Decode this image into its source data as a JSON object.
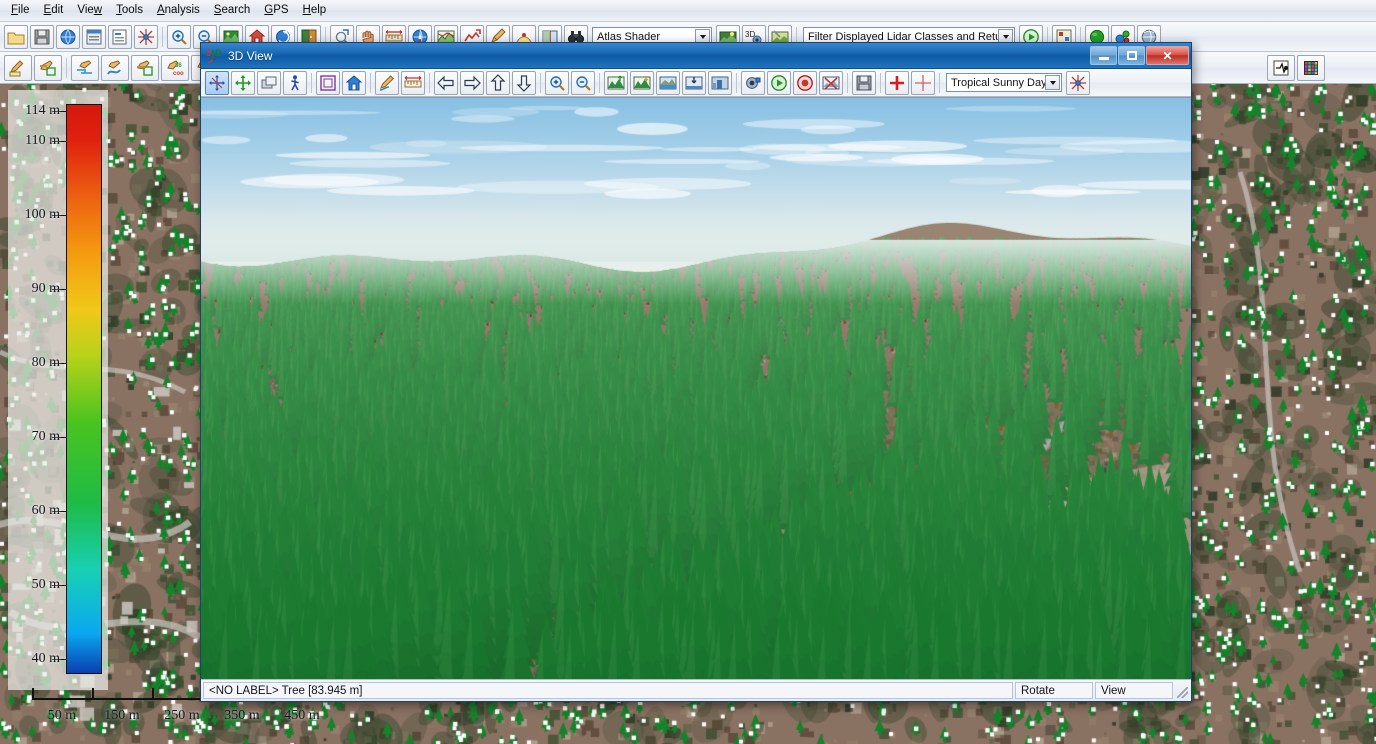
{
  "app": {
    "menu": [
      {
        "label": "File",
        "accel": "F"
      },
      {
        "label": "Edit",
        "accel": "E"
      },
      {
        "label": "View",
        "accel": "w"
      },
      {
        "label": "Tools",
        "accel": "T"
      },
      {
        "label": "Analysis",
        "accel": "A"
      },
      {
        "label": "Search",
        "accel": "S"
      },
      {
        "label": "GPS",
        "accel": "G"
      },
      {
        "label": "Help",
        "accel": "H"
      }
    ],
    "toolbar_row1": {
      "groups": [
        {
          "items": [
            {
              "name": "open-file-icon",
              "glyph": "folder"
            },
            {
              "name": "save-file-icon",
              "glyph": "floppy"
            },
            {
              "name": "globe-icon",
              "glyph": "globe"
            },
            {
              "name": "control-center-icon",
              "glyph": "window-list"
            },
            {
              "name": "layer-properties-icon",
              "glyph": "layers-doc"
            },
            {
              "name": "config-icon",
              "glyph": "config-star"
            }
          ]
        },
        {
          "items": [
            {
              "name": "zoom-in-icon",
              "glyph": "zoom-in"
            },
            {
              "name": "zoom-out-icon",
              "glyph": "zoom-out"
            },
            {
              "name": "full-view-icon",
              "glyph": "full-view"
            },
            {
              "name": "home-view-icon",
              "glyph": "home"
            },
            {
              "name": "previous-view-icon",
              "glyph": "reload-arrow"
            },
            {
              "name": "next-view-icon",
              "glyph": "door"
            }
          ]
        },
        {
          "items": [
            {
              "name": "zoom-tool-icon",
              "glyph": "magnify-rect"
            },
            {
              "name": "pan-tool-icon",
              "glyph": "hand"
            },
            {
              "name": "measure-tool-icon",
              "glyph": "ruler"
            },
            {
              "name": "feature-info-tool-icon",
              "glyph": "info-globe"
            },
            {
              "name": "path-profile-icon",
              "glyph": "profile"
            },
            {
              "name": "coverage-icon",
              "glyph": "coverage-red"
            },
            {
              "name": "digitizer-icon",
              "glyph": "digitizer"
            },
            {
              "name": "viewshed-icon",
              "glyph": "viewshed"
            },
            {
              "name": "image-swipe-icon",
              "glyph": "swipe"
            },
            {
              "name": "search-binoculars-icon",
              "glyph": "binoculars"
            }
          ]
        },
        {
          "items": []
        }
      ],
      "shader_combo": {
        "name": "shader-select",
        "value": "Atlas Shader"
      },
      "after_shader": [
        {
          "name": "shader-options-icon",
          "glyph": "shader-opt"
        },
        {
          "name": "enable-3d-icon",
          "glyph": "three-d"
        },
        {
          "name": "terrain-paint-icon",
          "glyph": "terrain-paint"
        }
      ],
      "filter_combo": {
        "name": "lidar-filter-select",
        "value": "Filter Displayed Lidar Classes and Return Types"
      },
      "after_filter": [
        {
          "name": "play-lidar-icon",
          "glyph": "play-green"
        },
        {
          "name": "lidar-draw-mode-icon",
          "glyph": "lidar-mode"
        },
        {
          "name": "green-sphere-icon",
          "glyph": "green-sphere"
        },
        {
          "name": "point-cloud-icon",
          "glyph": "point-cloud"
        },
        {
          "name": "globe-shade-icon",
          "glyph": "globe-shade"
        }
      ]
    },
    "toolbar_row2": {
      "items": [
        {
          "name": "digitize-area-icon",
          "glyph": "pen-area"
        },
        {
          "name": "digitize-rect-icon",
          "glyph": "pen-rect"
        },
        {
          "name": "digitize-line-icon",
          "glyph": "pen-line"
        },
        {
          "name": "digitize-curve-icon",
          "glyph": "pen-curve"
        },
        {
          "name": "digitize-square-icon",
          "glyph": "pen-square"
        },
        {
          "name": "digitize-coord-icon",
          "glyph": "pen-coord"
        },
        {
          "name": "digitize-range-rings-icon",
          "glyph": "pen-rings"
        },
        {
          "name": "edit-vertex-icon",
          "glyph": "pen-vertex"
        },
        {
          "name": "crop-combine-icon",
          "glyph": "crop"
        },
        {
          "name": "lidar-classify-icon",
          "glyph": "lidar-class"
        },
        {
          "name": "lidar-grid-icon",
          "glyph": "lidar-grid"
        }
      ]
    }
  },
  "legend": {
    "name": "elevation-color-legend",
    "unit": "m",
    "ticks": [
      {
        "label": "114 m",
        "value": 114
      },
      {
        "label": "110 m",
        "value": 110
      },
      {
        "label": "100 m",
        "value": 100
      },
      {
        "label": "90 m",
        "value": 90
      },
      {
        "label": "80 m",
        "value": 80
      },
      {
        "label": "70 m",
        "value": 70
      },
      {
        "label": "60 m",
        "value": 60
      },
      {
        "label": "50 m",
        "value": 50
      },
      {
        "label": "40 m",
        "value": 40
      }
    ],
    "min": 38,
    "max": 115,
    "gradient_stops": [
      {
        "pos": 0,
        "color": "#0a3fb0"
      },
      {
        "pos": 7,
        "color": "#0aa8f0"
      },
      {
        "pos": 18,
        "color": "#18d0b4"
      },
      {
        "pos": 30,
        "color": "#1fbb45"
      },
      {
        "pos": 44,
        "color": "#49c41f"
      },
      {
        "pos": 56,
        "color": "#b9d21a"
      },
      {
        "pos": 64,
        "color": "#f0c81a"
      },
      {
        "pos": 74,
        "color": "#f59a10"
      },
      {
        "pos": 84,
        "color": "#ec5f11"
      },
      {
        "pos": 94,
        "color": "#e02010"
      },
      {
        "pos": 100,
        "color": "#d5190c"
      }
    ]
  },
  "scalebar": {
    "name": "map-scale-bar",
    "labels": [
      "50 m",
      "150 m",
      "250 m",
      "350 m",
      "450 m"
    ],
    "tick_count": 6
  },
  "window3d": {
    "title": "3D View",
    "title_icon": "3d-axes-icon",
    "buttons": {
      "minimize": "minimize-button",
      "maximize": "maximize-button",
      "close": "close-button"
    },
    "toolbar": {
      "items": [
        {
          "name": "rotate-mode-icon",
          "glyph": "rotate-mode",
          "active": true
        },
        {
          "name": "pan-mode-icon",
          "glyph": "move-arrows"
        },
        {
          "name": "layers-icon",
          "glyph": "stack"
        },
        {
          "name": "walk-mode-icon",
          "glyph": "walker"
        },
        {
          "sep": true
        },
        {
          "name": "bounding-box-icon",
          "glyph": "bbox"
        },
        {
          "name": "home-view-icon",
          "glyph": "home-blue"
        },
        {
          "sep": true
        },
        {
          "name": "draw-path-icon",
          "glyph": "pencil-path"
        },
        {
          "name": "measure-icon",
          "glyph": "ruler-red"
        },
        {
          "sep": true
        },
        {
          "name": "rotate-left-icon",
          "glyph": "arrow-left"
        },
        {
          "name": "rotate-right-icon",
          "glyph": "arrow-right"
        },
        {
          "name": "tilt-up-icon",
          "glyph": "arrow-up"
        },
        {
          "name": "tilt-down-icon",
          "glyph": "arrow-down"
        },
        {
          "sep": true
        },
        {
          "name": "zoom-in-icon",
          "glyph": "zoom-in"
        },
        {
          "name": "zoom-out-icon",
          "glyph": "zoom-out"
        },
        {
          "sep": true
        },
        {
          "name": "vertical-exaggeration-up-icon",
          "glyph": "vexag-up"
        },
        {
          "name": "vertical-exaggeration-down-icon",
          "glyph": "vexag-down"
        },
        {
          "name": "water-level-icon",
          "glyph": "water"
        },
        {
          "name": "water-down-icon",
          "glyph": "water-down"
        },
        {
          "name": "texture-icon",
          "glyph": "texture"
        },
        {
          "sep": true
        },
        {
          "name": "record-settings-icon",
          "glyph": "camera-rec"
        },
        {
          "name": "play-flythrough-icon",
          "glyph": "play-green"
        },
        {
          "name": "stop-flythrough-icon",
          "glyph": "stop-red"
        },
        {
          "name": "export-image-icon",
          "glyph": "export-img"
        },
        {
          "sep": true
        },
        {
          "name": "save-view-icon",
          "glyph": "floppy-gray"
        },
        {
          "sep": true
        },
        {
          "name": "add-point-icon",
          "glyph": "plus-red"
        },
        {
          "name": "crosshair-icon",
          "glyph": "crosshair"
        },
        {
          "sep": true
        }
      ],
      "sky_combo": {
        "name": "sky-background-select",
        "value": "Tropical Sunny Day"
      },
      "after_combo": [
        {
          "name": "sky-settings-icon",
          "glyph": "config-star"
        }
      ]
    },
    "statusbar": {
      "feature": "<NO LABEL> Tree [83.945 m]",
      "mode": "Rotate",
      "panel": "View"
    }
  },
  "colors": {
    "accent_blue": "#0d5ba6",
    "title_gradient_start": "#3a85cc",
    "status_bg": "#f4f6fa",
    "sky_top": "#8fc6e8",
    "sky_bottom": "#eef3ee",
    "tree_green": "#1d6b2c",
    "terrain_brown": "#8a6f5c",
    "road_gray": "#9a9d9c"
  }
}
